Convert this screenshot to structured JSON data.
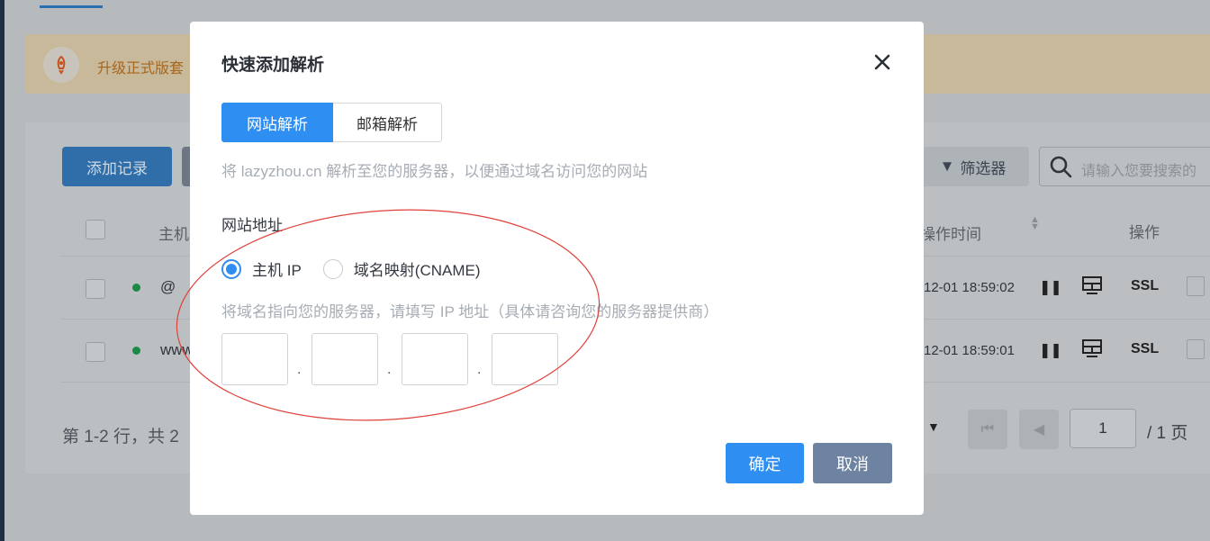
{
  "background": {
    "notice_text": "升级正式版套",
    "add_record_button": "添加记录",
    "filter_button": "筛选器",
    "search_placeholder": "请输入您要搜索的",
    "table": {
      "header_host": "主机",
      "header_time": "操作时间",
      "header_ops": "操作",
      "rows": [
        {
          "host": "@",
          "time": "12-01 18:59:02",
          "pause": "❚❚",
          "ssl": "SSL"
        },
        {
          "host": "www",
          "time": "12-01 18:59:01",
          "pause": "❚❚",
          "ssl": "SSL"
        }
      ]
    },
    "pager": {
      "summary": "第 1-2 行，共 2",
      "current_page": "1",
      "total": "/ 1 页"
    }
  },
  "modal": {
    "title": "快速添加解析",
    "tabs": [
      "网站解析",
      "邮箱解析"
    ],
    "active_tab": "网站解析",
    "description": "将 lazyzhou.cn 解析至您的服务器，以便通过域名访问您的网站",
    "field_label": "网站地址",
    "radio_options": [
      "主机 IP",
      "域名映射(CNAME)"
    ],
    "selected_option": "主机 IP",
    "hint": "将域名指向您的服务器，请填写 IP 地址（具体请咨询您的服务器提供商）",
    "ip_separator": ".",
    "confirm_button": "确定",
    "cancel_button": "取消"
  },
  "colors": {
    "primary": "#2f8ef1",
    "cancel": "#6e82a2",
    "annotation": "#e0403a"
  }
}
